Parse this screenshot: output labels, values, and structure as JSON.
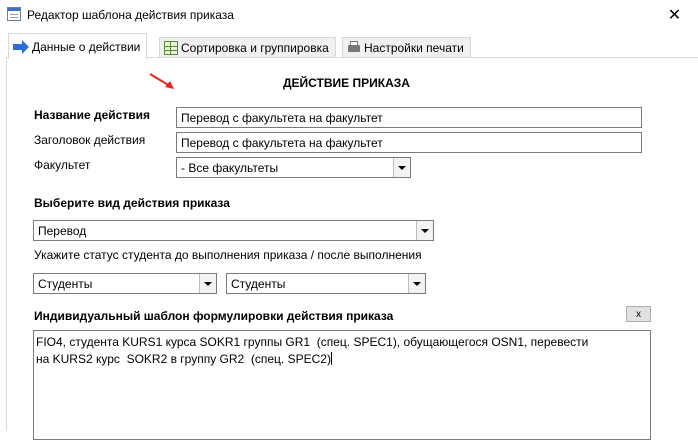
{
  "window": {
    "title": "Редактор шаблона действия приказа",
    "close_glyph": "✕"
  },
  "tabs": [
    {
      "label": "Данные о действии",
      "icon": "arrow-right-icon",
      "active": true
    },
    {
      "label": "Сортировка и группировка",
      "icon": "table-icon",
      "active": false
    },
    {
      "label": "Настройки печати",
      "icon": "printer-icon",
      "active": false
    }
  ],
  "form": {
    "section_title": "ДЕЙСТВИЕ ПРИКАЗА",
    "action_name_label": "Название действия",
    "action_name_value": "Перевод с факультета на факультет",
    "action_header_label": "Заголовок действия",
    "action_header_value": "Перевод с факультета на факультет",
    "faculty_label": "Факультет",
    "faculty_value": "- Все факультеты",
    "action_type_label": "Выберите вид действия приказа",
    "action_type_value": "Перевод",
    "status_hint": "Укажите статус студента до выполнения приказа / после выполнения",
    "status_before_value": "Студенты",
    "status_after_value": "Студенты",
    "template_label": "Индивидуальный шаблон формулировки действия приказа",
    "clear_button_label": "x",
    "template_text_line1": "FIO4, студента KURS1 курса SOKR1 группы GR1  (спец. SPEC1), обущающегося OSN1, перевести",
    "template_text_line2": "на KURS2 курс  SOKR2 в группу GR2  (спец. SPEC2)"
  },
  "colors": {
    "annotation_arrow": "#e8231d",
    "tab_arrow": "#2c6fd6"
  }
}
